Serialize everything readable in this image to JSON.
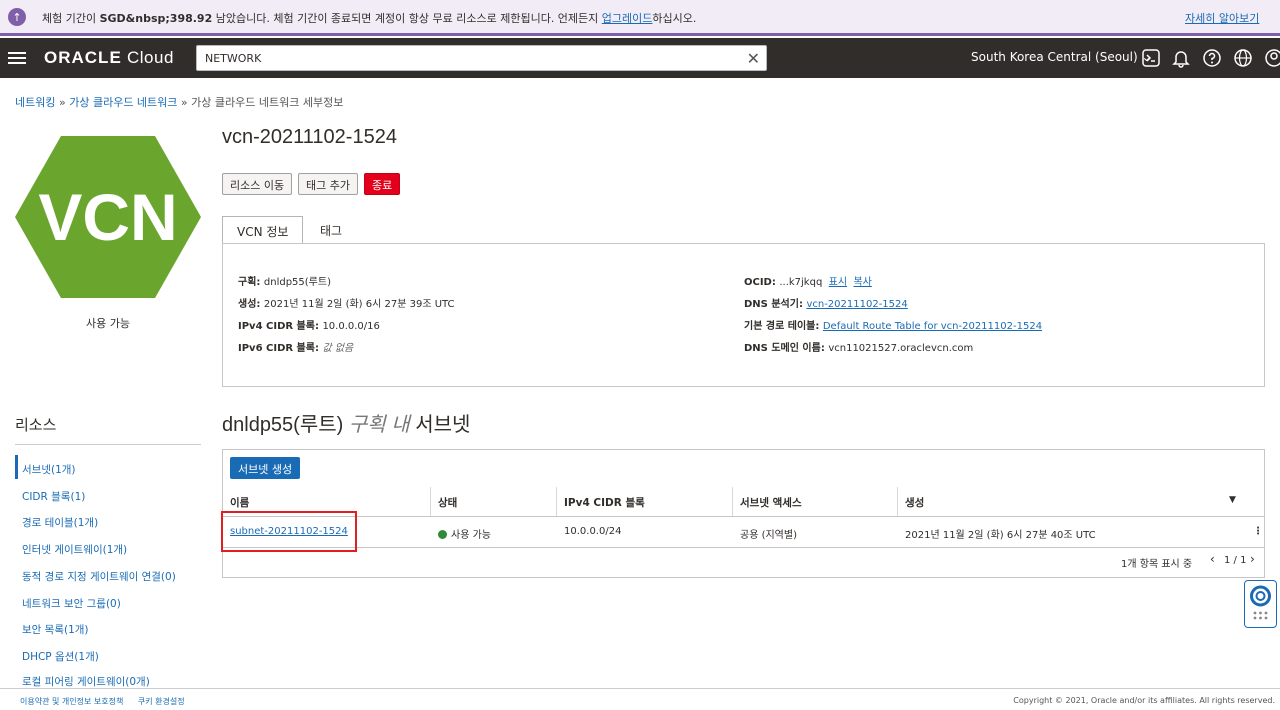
{
  "banner": {
    "msg_before": "체험 기간이 ",
    "msg_bold": "SGD&nbsp;398.92",
    "msg_after": " 남았습니다. 체험 기간이 종료되면 계정이 항상 무료 리소스로 제한됩니다. 언제든지 ",
    "upgrade_link": "업그레이드",
    "msg_end": "하십시오.",
    "more_link": "자세히 알아보기"
  },
  "header": {
    "logo_bold": "ORACLE",
    "logo_text": " Cloud",
    "search_value": "NETWORK",
    "region": "South Korea Central (Seoul)"
  },
  "breadcrumb": {
    "item1": "네트워킹",
    "sep": " » ",
    "item2": "가상 클라우드 네트워크",
    "item3": "가상 클라우드 네트워크 세부정보"
  },
  "vcn": {
    "icon_text": "VCN",
    "status": "사용 가능",
    "title": "vcn-20211102-1524",
    "buttons": {
      "move": "리소스 이동",
      "tag": "태그 추가",
      "terminate": "종료"
    },
    "tabs": {
      "info": "VCN 정보",
      "tags": "태그"
    },
    "info": {
      "compartment_label": "구획: ",
      "compartment_value": "dnldp55(루트)",
      "created_label": "생성: ",
      "created_value": "2021년 11월 2일 (화) 6시 27분 39조 UTC",
      "ipv4_label": "IPv4 CIDR 블록: ",
      "ipv4_value": "10.0.0.0/16",
      "ipv6_label": "IPv6 CIDR 블록: ",
      "ipv6_value": "값 없음",
      "ocid_label": "OCID: ",
      "ocid_value": "...k7jkqq",
      "ocid_show": "표시",
      "ocid_copy": "복사",
      "dns_resolver_label": "DNS 분석기: ",
      "dns_resolver_value": "vcn-20211102-1524",
      "route_label": "기본 경로 테이블: ",
      "route_value": "Default Route Table for vcn-20211102-1524",
      "dns_domain_label": "DNS 도메인 이름: ",
      "dns_domain_value": "vcn11021527.oraclevcn.com"
    }
  },
  "resources": {
    "title": "리소스",
    "items": [
      "서브넷(1개)",
      "CIDR 블록(1)",
      "경로 테이블(1개)",
      "인터넷 게이트웨이(1개)",
      "동적 경로 지정 게이트웨이 연결(0)",
      "네트워크 보안 그룹(0)",
      "보안 목록(1개)",
      "DHCP 옵션(1개)",
      "로컬 피어링 게이트웨이(0개)"
    ]
  },
  "subnets": {
    "title_main": "dnldp55(루트)",
    "title_italic": " 구획 내 ",
    "title_end": "서브넷",
    "create_button": "서브넷 생성",
    "columns": [
      "이름",
      "상태",
      "IPv4 CIDR 블록",
      "서브넷 액세스",
      "생성"
    ],
    "row": {
      "name": "subnet-20211102-1524",
      "state": "사용 가능",
      "cidr": "10.0.0.0/24",
      "access": "공용 (지역별)",
      "created": "2021년 11월 2일 (화) 6시 27분 40조 UTC"
    },
    "pager_count": "1개 항목 표시 중",
    "pager_page": "1 / 1"
  },
  "footer": {
    "terms": "이용약관 및 개인정보 보호정책",
    "cookies": "쿠키 환경설정",
    "copyright": "Copyright © 2021, Oracle and/or its affiliates. All rights reserved."
  },
  "colors": {
    "brand_bar": "#312d2a",
    "vcn_green": "#6aa52e",
    "link_blue": "#1a6bb5",
    "danger_red": "#e3001b",
    "status_green": "#2f8a3a"
  }
}
